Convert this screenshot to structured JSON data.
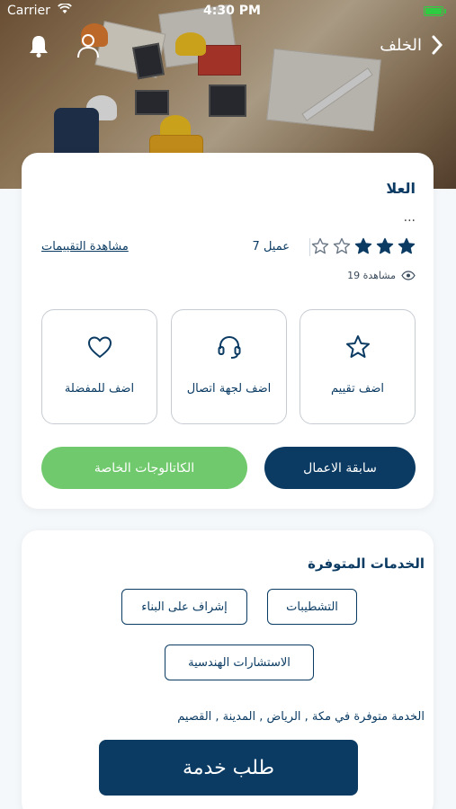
{
  "status_bar": {
    "carrier": "Carrier",
    "time": "4:30 PM"
  },
  "header": {
    "back_label": "الخلف"
  },
  "company": {
    "name": "العلا",
    "description": "...",
    "rating": 3,
    "rating_max": 5,
    "workers": "7 عميل",
    "reviews_link": "مشاهدة التقييمات",
    "views": "19 مشاهدة"
  },
  "actions": {
    "rate": "اضف تقييم",
    "contact": "اضف لجهة اتصال",
    "favorite": "اضف للمفضلة"
  },
  "buttons": {
    "previous_works": "سابقة الاعمال",
    "catalogs": "الكاتالوجات الخاصة"
  },
  "services": {
    "title": "الخدمات المتوفرة",
    "items": [
      "التشطيبات",
      "إشراف على البناء",
      "الاستشارات الهندسية"
    ],
    "availability": "الخدمة متوفرة في مكة , الرياض , المدينة , القصيم",
    "request_button": "طلب خدمة"
  },
  "colors": {
    "primary": "#0b3b63",
    "green": "#71c96d",
    "battery": "#2ecc40"
  }
}
